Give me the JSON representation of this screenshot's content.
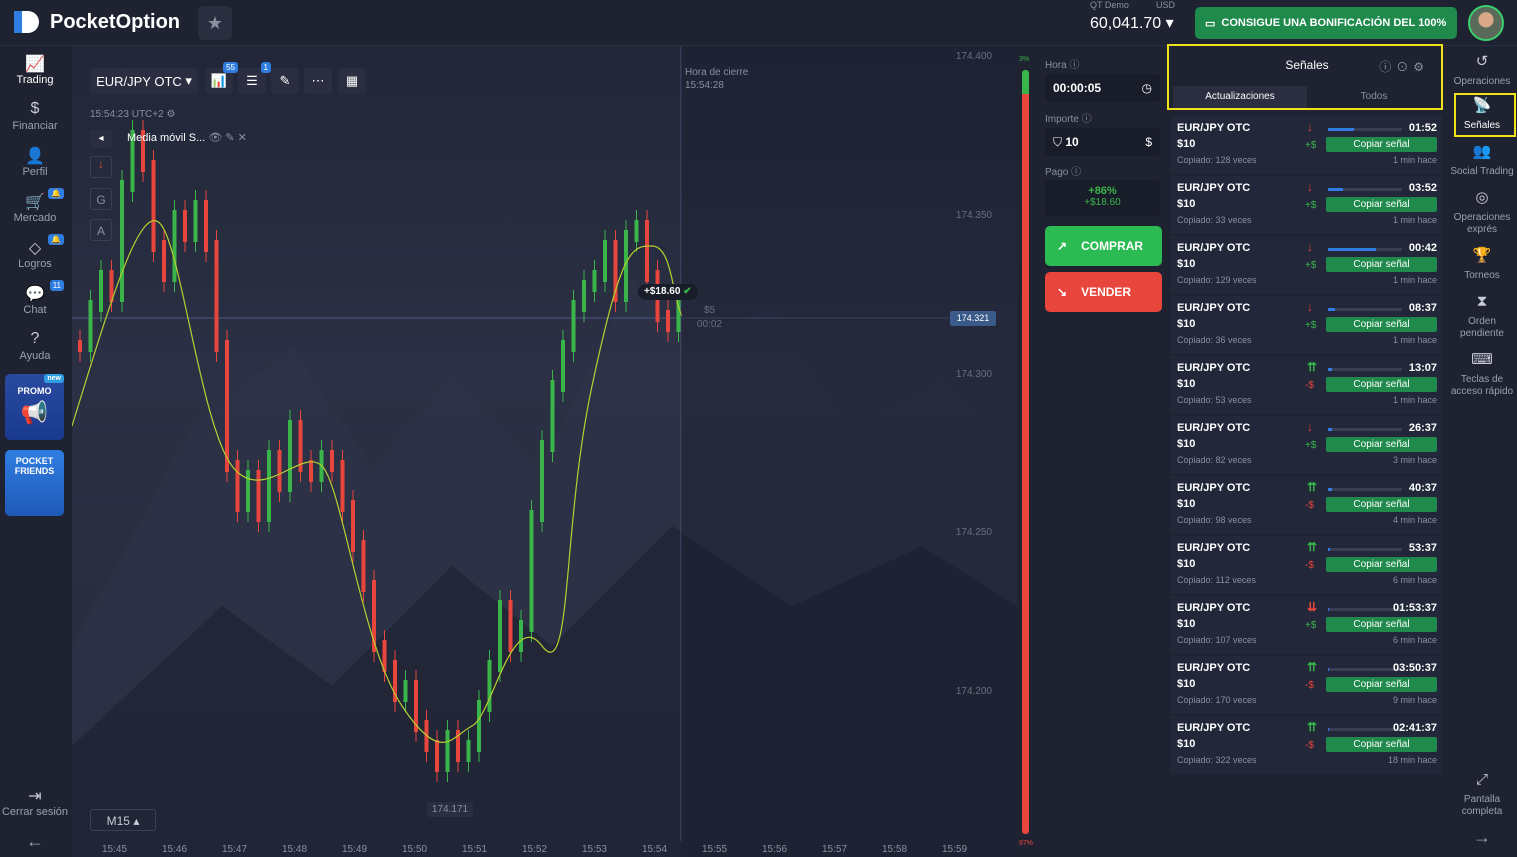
{
  "header": {
    "logo": "PocketOption",
    "account_label": "QT Demo",
    "account_currency": "USD",
    "balance": "60,041.70",
    "bonus": "CONSIGUE UNA BONIFICACIÓN DEL 100%"
  },
  "leftnav": [
    {
      "label": "Trading",
      "icon": "chart-line-icon"
    },
    {
      "label": "Financiar",
      "icon": "dollar-icon"
    },
    {
      "label": "Perfil",
      "icon": "user-icon"
    },
    {
      "label": "Mercado",
      "icon": "cart-icon"
    },
    {
      "label": "Logros",
      "icon": "diamond-icon"
    },
    {
      "label": "Chat",
      "icon": "chat-icon",
      "badge": "11"
    },
    {
      "label": "Ayuda",
      "icon": "help-icon"
    }
  ],
  "promo": {
    "label": "PROMO",
    "new": "new"
  },
  "friends": {
    "label": "POCKET FRIENDS"
  },
  "logout": "Cerrar sesión",
  "toolbar": {
    "pair": "EUR/JPY OTC",
    "badge1": "55",
    "badge2": "1"
  },
  "indicator": {
    "name": "Media móvil S...",
    "time": "15:54:23",
    "tf_overlay": "UTC+2"
  },
  "chart": {
    "close_label": "Hora de cierre",
    "close_time": "15:54:28",
    "price_tag": "174.321",
    "low_tag": "174.171",
    "profit_tag": "+$18.60",
    "bet_label": "$5",
    "bet_timer": "00:02",
    "timeframe": "M15",
    "yticks": [
      "174.400",
      "174.350",
      "174.300",
      "174.250",
      "174.200"
    ],
    "xticks": [
      "15:45",
      "15:46",
      "15:47",
      "15:48",
      "15:49",
      "15:50",
      "15:51",
      "15:52",
      "15:53",
      "15:54",
      "15:55",
      "15:56",
      "15:57",
      "15:58",
      "15:59"
    ],
    "sentiment_top": "3%",
    "sentiment_bottom": "97%"
  },
  "trade": {
    "hora_label": "Hora",
    "hora": "00:00:05",
    "importe_label": "Importe",
    "importe": "10",
    "pago_label": "Pago",
    "pago_pct": "+86%",
    "pago_amt": "+$18.60",
    "buy": "COMPRAR",
    "sell": "VENDER"
  },
  "signals": {
    "title": "Señales",
    "tab_updates": "Actualizaciones",
    "tab_all": "Todos",
    "items": [
      {
        "pair": "EUR/JPY OTC",
        "amount": "$10",
        "copied": "Copiado: 128 veces",
        "dir": "↓",
        "pl": "+$",
        "time": "01:52",
        "btn": "Copiar señal",
        "ago": "1 min hace",
        "progress": 0.35
      },
      {
        "pair": "EUR/JPY OTC",
        "amount": "$10",
        "copied": "Copiado: 33 veces",
        "dir": "↓",
        "pl": "+$",
        "time": "03:52",
        "btn": "Copiar señal",
        "ago": "1 min hace",
        "progress": 0.2
      },
      {
        "pair": "EUR/JPY OTC",
        "amount": "$10",
        "copied": "Copiado: 129 veces",
        "dir": "↓",
        "pl": "+$",
        "time": "00:42",
        "btn": "Copiar señal",
        "ago": "1 min hace",
        "progress": 0.65
      },
      {
        "pair": "EUR/JPY OTC",
        "amount": "$10",
        "copied": "Copiado: 36 veces",
        "dir": "↓",
        "pl": "+$",
        "time": "08:37",
        "btn": "Copiar señal",
        "ago": "1 min hace",
        "progress": 0.1
      },
      {
        "pair": "EUR/JPY OTC",
        "amount": "$10",
        "copied": "Copiado: 53 veces",
        "dir": "⇈",
        "pl": "-$",
        "time": "13:07",
        "btn": "Copiar señal",
        "ago": "1 min hace",
        "progress": 0.05
      },
      {
        "pair": "EUR/JPY OTC",
        "amount": "$10",
        "copied": "Copiado: 82 veces",
        "dir": "↓",
        "pl": "+$",
        "time": "26:37",
        "btn": "Copiar señal",
        "ago": "3 min hace",
        "progress": 0.05
      },
      {
        "pair": "EUR/JPY OTC",
        "amount": "$10",
        "copied": "Copiado: 98 veces",
        "dir": "⇈",
        "pl": "-$",
        "time": "40:37",
        "btn": "Copiar señal",
        "ago": "4 min hace",
        "progress": 0.05
      },
      {
        "pair": "EUR/JPY OTC",
        "amount": "$10",
        "copied": "Copiado: 112 veces",
        "dir": "⇈",
        "pl": "-$",
        "time": "53:37",
        "btn": "Copiar señal",
        "ago": "6 min hace",
        "progress": 0.03
      },
      {
        "pair": "EUR/JPY OTC",
        "amount": "$10",
        "copied": "Copiado: 107 veces",
        "dir": "⇊",
        "pl": "+$",
        "time": "01:53:37",
        "btn": "Copiar señal",
        "ago": "6 min hace",
        "progress": 0.02
      },
      {
        "pair": "EUR/JPY OTC",
        "amount": "$10",
        "copied": "Copiado: 170 veces",
        "dir": "⇈",
        "pl": "-$",
        "time": "03:50:37",
        "btn": "Copiar señal",
        "ago": "9 min hace",
        "progress": 0.01
      },
      {
        "pair": "EUR/JPY OTC",
        "amount": "$10",
        "copied": "Copiado: 322 veces",
        "dir": "⇈",
        "pl": "-$",
        "time": "02:41:37",
        "btn": "Copiar señal",
        "ago": "18 min hace",
        "progress": 0.01
      }
    ]
  },
  "rightnav": [
    {
      "label": "Operaciones",
      "icon": "history-icon"
    },
    {
      "label": "Señales",
      "icon": "signal-icon"
    },
    {
      "label": "Social Trading",
      "icon": "users-icon"
    },
    {
      "label": "Operaciones exprés",
      "icon": "target-icon"
    },
    {
      "label": "Torneos",
      "icon": "trophy-icon"
    },
    {
      "label": "Orden pendiente",
      "icon": "hourglass-icon"
    },
    {
      "label": "Teclas de acceso rápido",
      "icon": "keyboard-icon"
    },
    {
      "label": "Pantalla completa",
      "icon": "fullscreen-icon"
    }
  ],
  "colors": {
    "up": "#3ab54a",
    "down": "#e8453c",
    "accent": "#2f7de1",
    "highlight": "#f0e21a"
  }
}
